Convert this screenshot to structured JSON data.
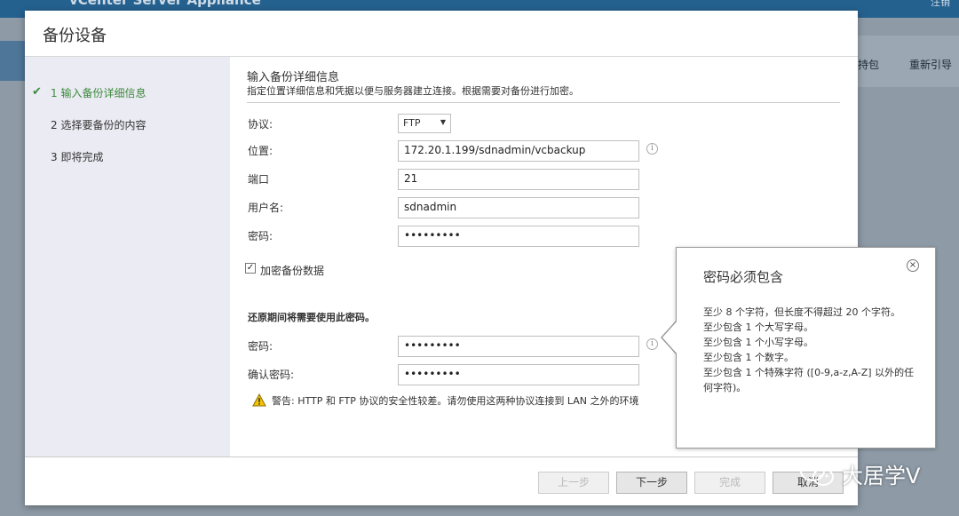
{
  "background": {
    "app_title": "vCenter Server Appliance",
    "logout": "注销",
    "toolbar_items": [
      "持包",
      "重新引导"
    ]
  },
  "dialog": {
    "title": "备份设备",
    "steps": [
      {
        "label": "1 输入备份详细信息",
        "active": true
      },
      {
        "label": "2 选择要备份的内容",
        "active": false
      },
      {
        "label": "3 即将完成",
        "active": false
      }
    ],
    "section": {
      "title": "输入备份详细信息",
      "subtitle": "指定位置详细信息和凭据以便与服务器建立连接。根据需要对备份进行加密。"
    },
    "form": {
      "protocol_label": "协议:",
      "protocol_value": "FTP",
      "location_label": "位置:",
      "location_value": "172.20.1.199/sdnadmin/vcbackup",
      "port_label": "端口",
      "port_value": "21",
      "username_label": "用户名:",
      "username_value": "sdnadmin",
      "password_label": "密码:",
      "password_value": "•••••••••",
      "encrypt_label": "加密备份数据",
      "encrypt_checked": true,
      "restore_note": "还原期间将需要使用此密码。",
      "enc_password_label": "密码:",
      "enc_password_value": "•••••••••",
      "confirm_label": "确认密码:",
      "confirm_value": "•••••••••",
      "warning": "警告: HTTP 和 FTP 协议的安全性较差。请勿使用这两种协议连接到 LAN 之外的环境"
    },
    "buttons": {
      "back": "上一步",
      "next": "下一步",
      "finish": "完成",
      "cancel": "取消"
    }
  },
  "tooltip": {
    "title": "密码必须包含",
    "rules": [
      "至少 8 个字符，但长度不得超过 20 个字符。",
      "至少包含 1 个大写字母。",
      "至少包含 1 个小写字母。",
      "至少包含 1 个数字。",
      "至少包含 1 个特殊字符 ([0-9,a-z,A-Z] 以外的任何字符)。"
    ]
  },
  "watermark": {
    "text": "大居学V"
  },
  "colors": {
    "active_step": "#3c8a3c",
    "sidebar_bg": "#ebebf3",
    "header_bar": "#25618f"
  }
}
